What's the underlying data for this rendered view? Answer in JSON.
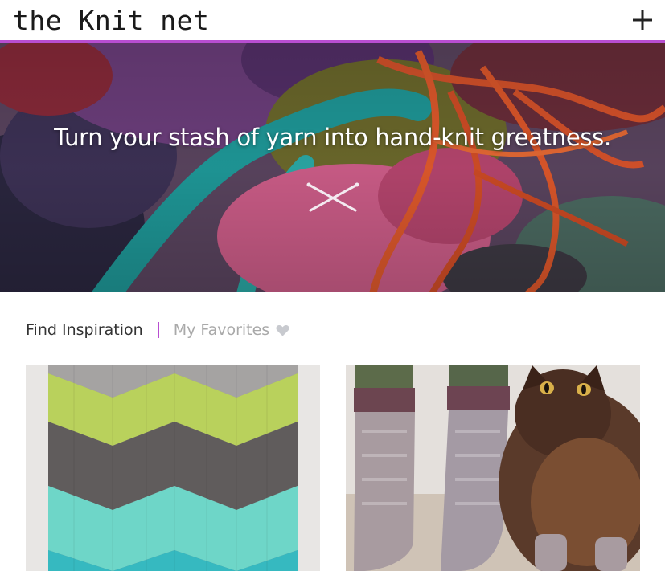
{
  "header": {
    "logo_text": "the Knit net",
    "add_icon": "plus-icon"
  },
  "hero": {
    "headline": "Turn your stash of yarn into hand-knit greatness.",
    "icon": "knitting-needles-icon"
  },
  "tabs": {
    "active_label": "Find Inspiration",
    "inactive_label": "My Favorites",
    "favorites_icon": "heart-icon"
  },
  "colors": {
    "accent": "#b84ed1",
    "text_dark": "#333333",
    "text_muted": "#a9a9a9"
  },
  "cards": [
    {
      "image": "chevron-knit-blanket-photo"
    },
    {
      "image": "hand-knit-socks-with-cat-photo"
    }
  ]
}
